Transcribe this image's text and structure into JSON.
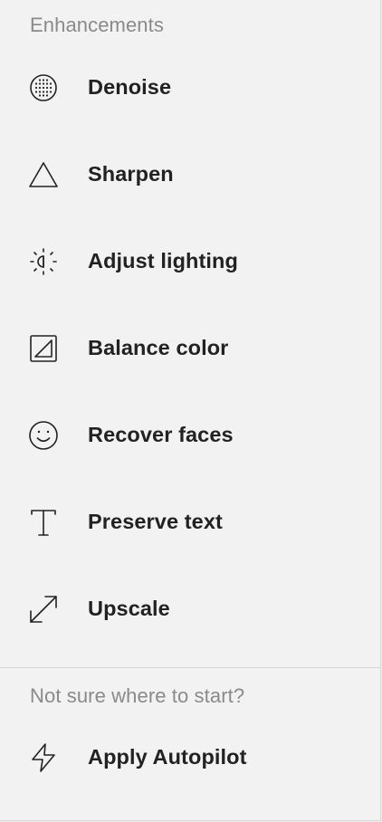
{
  "enhancements": {
    "heading": "Enhancements",
    "items": [
      {
        "label": "Denoise",
        "icon": "denoise-grid-icon"
      },
      {
        "label": "Sharpen",
        "icon": "triangle-icon"
      },
      {
        "label": "Adjust lighting",
        "icon": "light-icon"
      },
      {
        "label": "Balance color",
        "icon": "color-square-icon"
      },
      {
        "label": "Recover faces",
        "icon": "smiley-icon"
      },
      {
        "label": "Preserve text",
        "icon": "text-t-icon"
      },
      {
        "label": "Upscale",
        "icon": "expand-arrows-icon"
      }
    ]
  },
  "autopilot": {
    "heading": "Not sure where to start?",
    "label": "Apply Autopilot",
    "icon": "lightning-icon"
  }
}
